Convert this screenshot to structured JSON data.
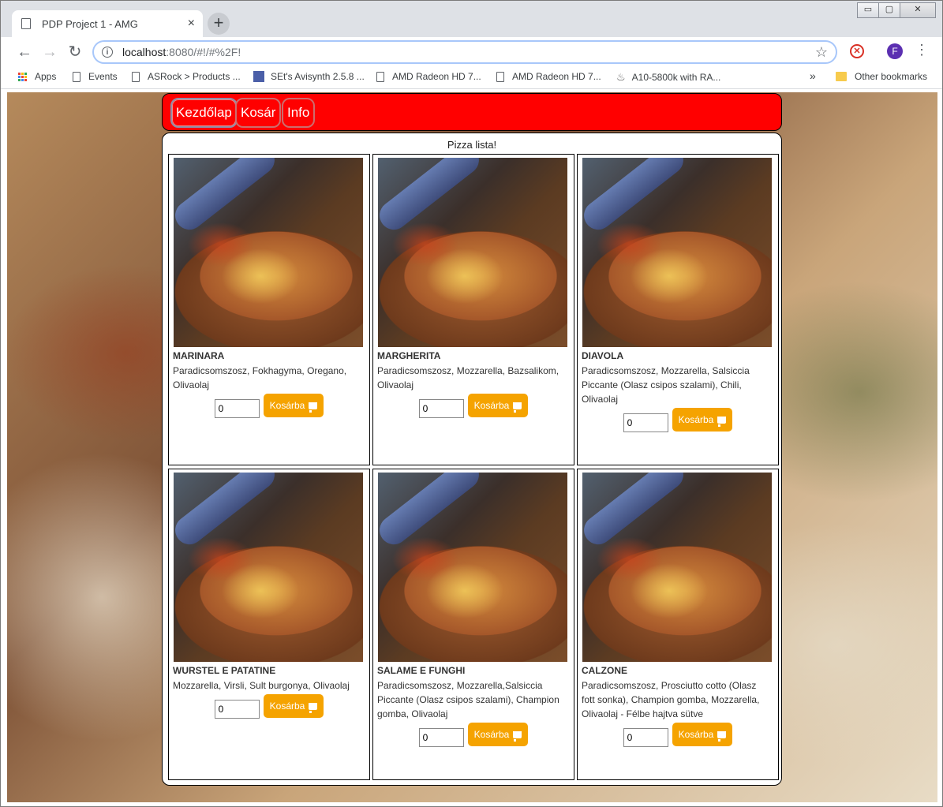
{
  "browser": {
    "tab_title": "PDP Project 1 - AMG",
    "tab_close": "×",
    "new_tab": "+",
    "window_min": "▭",
    "window_max": "▢",
    "window_close": "✕",
    "url_host": "localhost",
    "url_rest": ":8080/#!/#%2F!",
    "avatar_letter": "F",
    "bookmarks": [
      {
        "label": "Apps",
        "icon": "apps-grid-icon"
      },
      {
        "label": "Events",
        "icon": "page-icon"
      },
      {
        "label": "ASRock > Products ...",
        "icon": "page-icon"
      },
      {
        "label": "SEt's Avisynth 2.5.8 ...",
        "icon": "site-icon"
      },
      {
        "label": "AMD Radeon HD 7...",
        "icon": "page-icon"
      },
      {
        "label": "AMD Radeon HD 7...",
        "icon": "page-icon"
      },
      {
        "label": "A10-5800k with RA...",
        "icon": "flame-icon"
      }
    ],
    "bookmarks_overflow": "»",
    "other_bookmarks": "Other bookmarks"
  },
  "navbar": {
    "items": [
      "Kezdőlap",
      "Kosár",
      "Info"
    ],
    "active_index": 0
  },
  "page": {
    "heading": "Pizza lista!",
    "order_button": "Kosárba",
    "pizzas": [
      {
        "name": "MARINARA",
        "desc": "Paradicsomszosz, Fokhagyma, Oregano, Olivaolaj",
        "qty": "0"
      },
      {
        "name": "MARGHERITA",
        "desc": "Paradicsomszosz, Mozzarella, Bazsalikom, Olivaolaj",
        "qty": "0"
      },
      {
        "name": "DIAVOLA",
        "desc": "Paradicsomszosz, Mozzarella, Salsiccia Piccante (Olasz csipos szalami), Chili, Olivaolaj",
        "qty": "0"
      },
      {
        "name": "WURSTEL E PATATINE",
        "desc": "Mozzarella, Virsli, Sult burgonya, Olivaolaj",
        "qty": "0"
      },
      {
        "name": "SALAME E FUNGHI",
        "desc": "Paradicsomszosz, Mozzarella,Salsiccia Piccante (Olasz csipos szalami), Champion gomba, Olivaolaj",
        "qty": "0"
      },
      {
        "name": "CALZONE",
        "desc": "Paradicsomszosz, Prosciutto cotto (Olasz fott sonka), Champion gomba, Mozzarella, Olivaolaj - Félbe hajtva sütve",
        "qty": "0"
      }
    ]
  },
  "colors": {
    "navbar_bg": "#ff0000",
    "order_button_bg": "#f5a300"
  }
}
